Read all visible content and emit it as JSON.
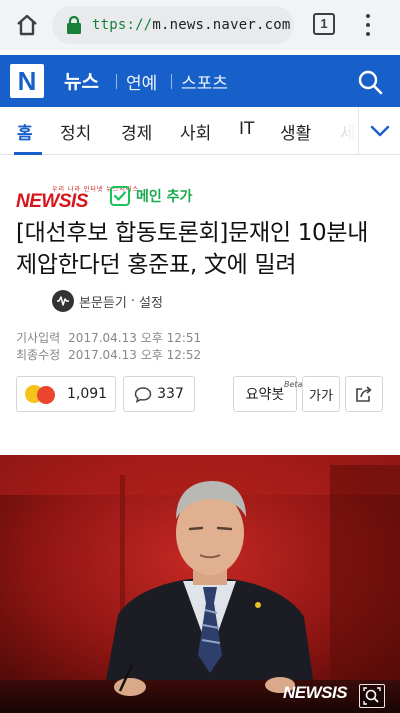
{
  "browser": {
    "url_scheme": "ttps://",
    "url_host": "m.news.naver.com",
    "tab_count": "1"
  },
  "header": {
    "logo": "N",
    "news": "뉴스",
    "entertainment": "연예",
    "sports": "스포츠"
  },
  "categories": {
    "items": [
      "홈",
      "정치",
      "경제",
      "사회",
      "IT",
      "생활",
      "세"
    ],
    "active_index": 0
  },
  "article": {
    "press_name": "NEWSIS",
    "press_tagline": "우리 나라 인터넷 뉴스서비스",
    "main_add_label": "메인 추가",
    "headline": "[대선후보 합동토론회]문재인 10분내 제압한다던 홍준표, 文에 밀려",
    "listen_label": "본문듣기",
    "listen_dot": "·",
    "listen_settings": "설정",
    "input_label": "기사입력",
    "input_time": "2017.04.13 오후 12:51",
    "modified_label": "최종수정",
    "modified_time": "2017.04.13 오후 12:52",
    "reaction_count": "1,091",
    "comment_count": "337",
    "summary_label": "요약봇",
    "summary_beta": "Beta",
    "font_size_label": "가가",
    "photo_watermark": "NEWSIS"
  },
  "colors": {
    "naver_blue": "#1860c9",
    "green": "#19c25a",
    "newsis_red": "#d7151c"
  }
}
